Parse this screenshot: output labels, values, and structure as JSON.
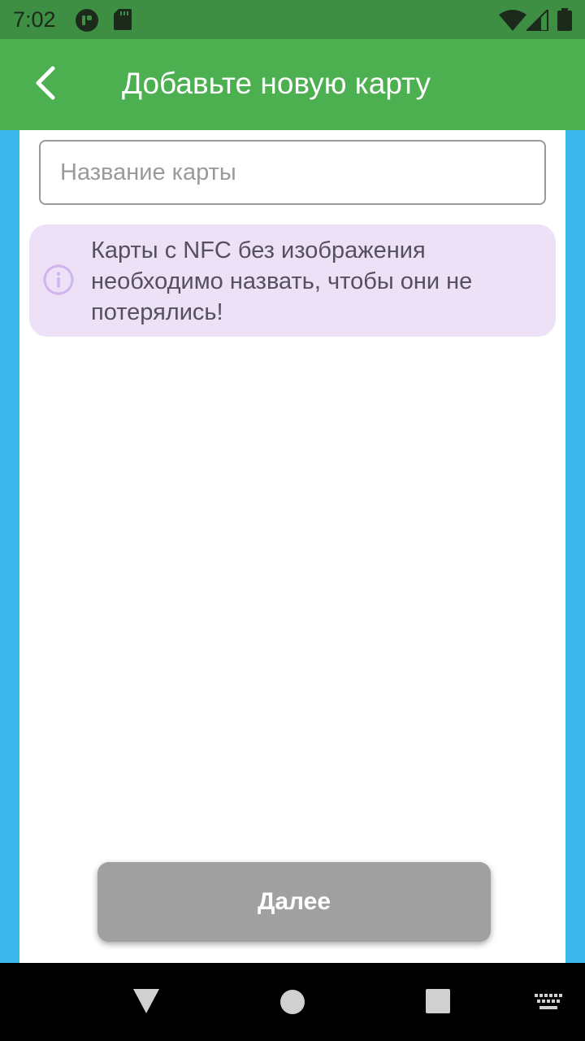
{
  "status_bar": {
    "time": "7:02",
    "icons": [
      "notification-app-icon",
      "sd-card-icon",
      "wifi-icon",
      "signal-icon",
      "battery-icon"
    ]
  },
  "app_bar": {
    "title": "Добавьте новую карту",
    "back_icon": "chevron-left-icon"
  },
  "form": {
    "name_placeholder": "Название карты",
    "name_value": ""
  },
  "info": {
    "icon": "info-icon",
    "text": "Карты с NFC без изображения необходимо назвать, чтобы они не потерялись!"
  },
  "next_button": {
    "label": "Далее"
  },
  "nav_bar": {
    "icons": [
      "back-triangle-icon",
      "home-circle-icon",
      "recents-square-icon",
      "keyboard-icon"
    ]
  },
  "colors": {
    "app_bar": "#4caf50",
    "status_bar": "#3e8e43",
    "side_background": "#3cb8ef",
    "info_background": "#ede1f7",
    "button_disabled": "#a0a0a0"
  }
}
